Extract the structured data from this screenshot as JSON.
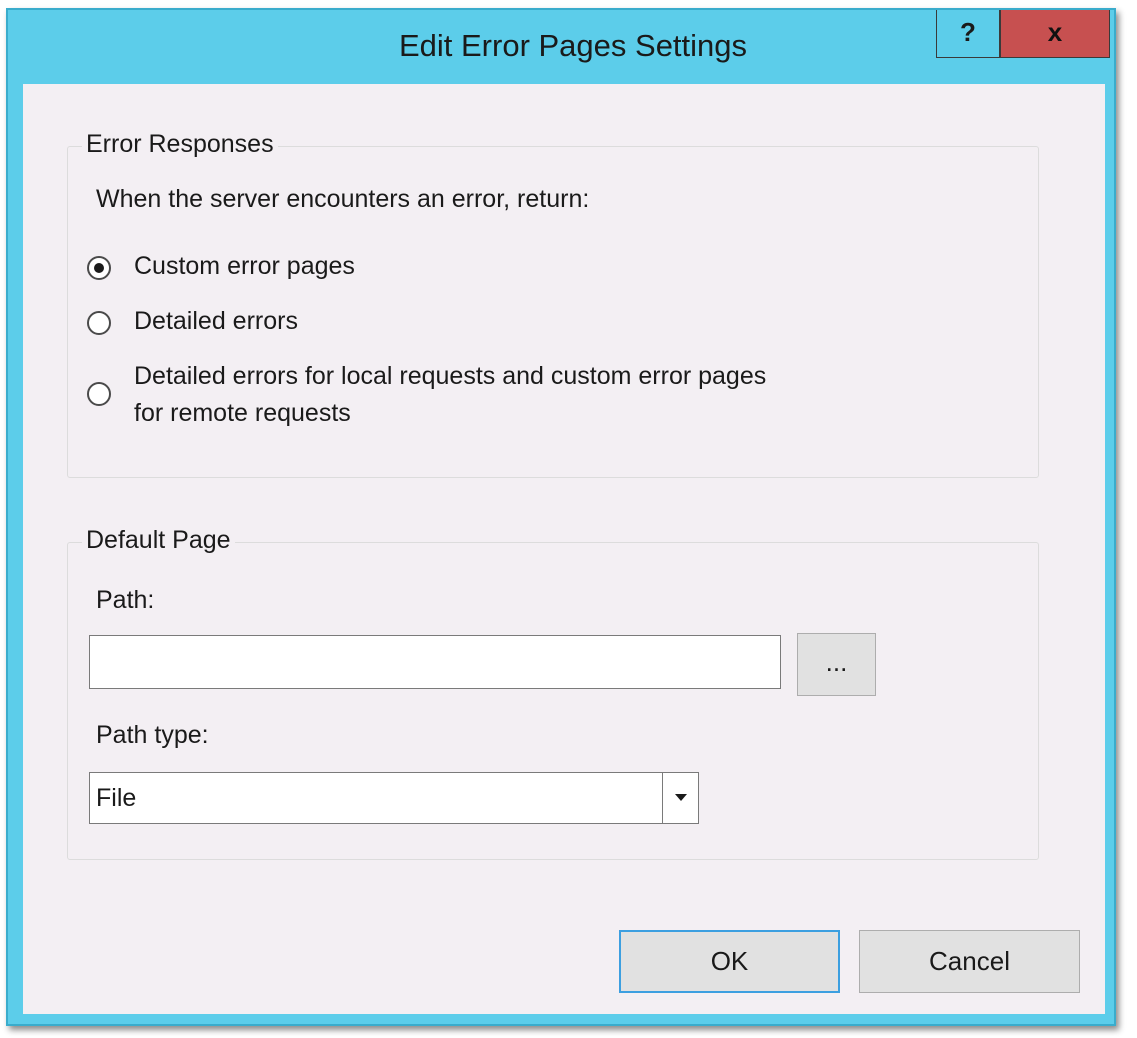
{
  "window": {
    "title": "Edit Error Pages Settings",
    "help_label": "?",
    "close_label": "x"
  },
  "error_responses": {
    "group_label": "Error Responses",
    "prompt": "When the server encounters an error, return:",
    "options": [
      {
        "label": "Custom error pages",
        "selected": true
      },
      {
        "label": "Detailed errors",
        "selected": false
      },
      {
        "label_line1": "Detailed errors for local requests and custom error pages",
        "label_line2": "for remote requests",
        "selected": false
      }
    ]
  },
  "default_page": {
    "group_label": "Default Page",
    "path_label": "Path:",
    "path_value": "",
    "browse_label": "...",
    "path_type_label": "Path type:",
    "path_type_value": "File"
  },
  "buttons": {
    "ok_label": "OK",
    "cancel_label": "Cancel"
  },
  "colors": {
    "title_bar": "#5ccdea",
    "close_button": "#c75050",
    "client_background": "#f3eff3",
    "default_button_border": "#3c9fe0"
  },
  "icons": {
    "help": "question-mark-icon",
    "close": "close-icon",
    "dropdown": "chevron-down-icon"
  }
}
